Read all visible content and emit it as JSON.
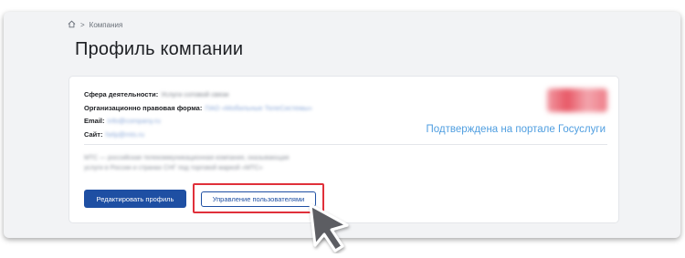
{
  "breadcrumb": {
    "separator": ">",
    "current": "Компания"
  },
  "page": {
    "title": "Профиль компании"
  },
  "company": {
    "activity_label": "Сфера деятельности:",
    "activity_value": "Услуги сотовой связи",
    "legal_form_label": "Организационно правовая форма:",
    "legal_form_value": "ПАО «Мобильные ТелеСистемы»",
    "email_label": "Email:",
    "email_value": "info@company.ru",
    "site_label": "Сайт:",
    "site_value": "help@mts.ru",
    "verified_text": "Подтверждена на портале Госуслуги",
    "description_line1": "МТС — российская телекоммуникационная компания, оказывающая",
    "description_line2": "услуги в России и странах СНГ под торговой маркой «МТС»"
  },
  "actions": {
    "edit_profile": "Редактировать профиль",
    "manage_users": "Управление пользователями"
  },
  "colors": {
    "primary": "#1e4fa3",
    "link": "#4f9ee0",
    "highlight": "#e0303a",
    "background": "#f2f3f5"
  },
  "icons": {
    "home": "home-icon",
    "cursor": "cursor-arrow-icon"
  }
}
